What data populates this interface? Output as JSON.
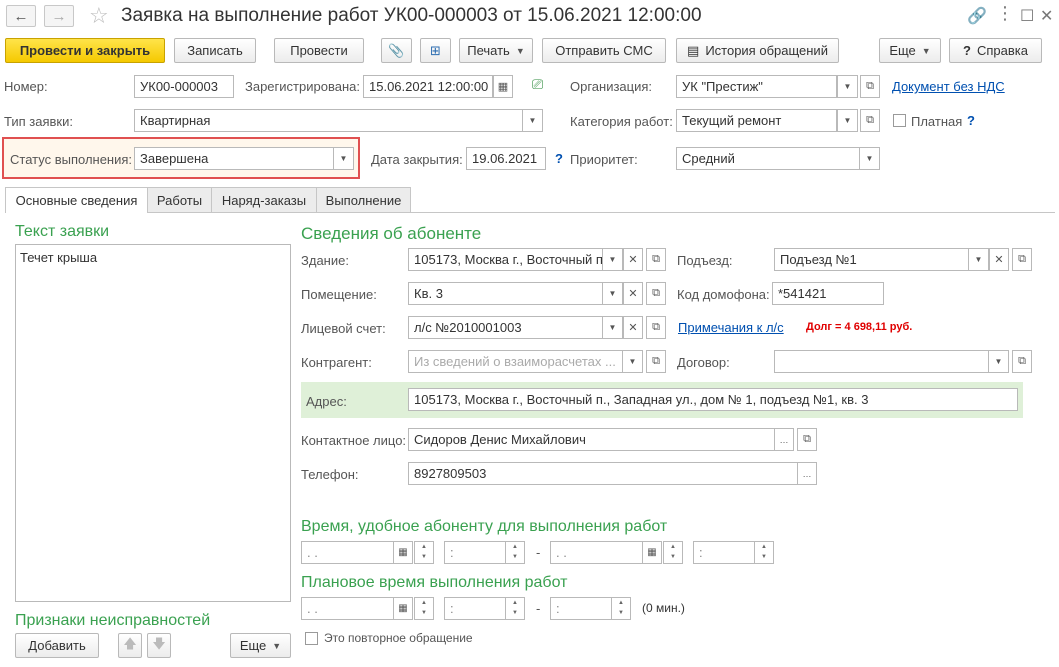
{
  "window": {
    "title": "Заявка на выполнение работ УК00-000003 от 15.06.2021 12:00:00"
  },
  "toolbar": {
    "post_close": "Провести и закрыть",
    "save": "Записать",
    "post": "Провести",
    "print": "Печать",
    "send_sms": "Отправить СМС",
    "history": "История обращений",
    "more": "Еще",
    "help": "Справка"
  },
  "header": {
    "number_label": "Номер:",
    "number_value": "УК00-000003",
    "registered_label": "Зарегистрирована:",
    "registered_value": "15.06.2021 12:00:00",
    "org_label": "Организация:",
    "org_value": "УК \"Престиж\"",
    "no_vat_link": "Документ без НДС",
    "type_label": "Тип заявки:",
    "type_value": "Квартирная",
    "category_label": "Категория работ:",
    "category_value": "Текущий ремонт",
    "paid_label": "Платная",
    "paid_help": "?",
    "status_label": "Статус выполнения:",
    "status_value": "Завершена",
    "close_date_label": "Дата закрытия:",
    "close_date_value": "19.06.2021",
    "close_date_help": "?",
    "priority_label": "Приоритет:",
    "priority_value": "Средний"
  },
  "tabs": [
    {
      "label": "Основные сведения"
    },
    {
      "label": "Работы"
    },
    {
      "label": "Наряд-заказы"
    },
    {
      "label": "Выполнение"
    }
  ],
  "left": {
    "text_header": "Текст заявки",
    "text_value": "Течет крыша",
    "defects_header": "Признаки неисправностей",
    "add_button": "Добавить",
    "more_button": "Еще"
  },
  "subscriber": {
    "header": "Сведения об абоненте",
    "building_label": "Здание:",
    "building_value": "105173, Москва г., Восточный п",
    "entrance_label": "Подъезд:",
    "entrance_value": "Подъезд №1",
    "room_label": "Помещение:",
    "room_value": "Кв. 3",
    "intercom_label": "Код домофона:",
    "intercom_value": "*541421",
    "account_label": "Лицевой счет:",
    "account_value": "л/с №2010001003",
    "account_notes_link": "Примечания к л/с",
    "debt_text": "Долг = 4 698,11 руб.",
    "counterparty_label": "Контрагент:",
    "counterparty_placeholder": "Из сведений о взаиморасчетах ...",
    "contract_label": "Договор:",
    "contract_value": "",
    "address_label": "Адрес:",
    "address_value": "105173, Москва г., Восточный п., Западная ул., дом № 1, подъезд №1, кв. 3",
    "contact_label": "Контактное лицо:",
    "contact_value": "Сидоров Денис Михайлович",
    "phone_label": "Телефон:",
    "phone_value": "8927809503"
  },
  "schedule": {
    "convenient_header": "Время, удобное абоненту для выполнения работ",
    "planned_header": "Плановое время выполнения работ",
    "date_placeholder": " .  .",
    "time_placeholder": ":",
    "dash": "-",
    "duration": "(0 мин.)",
    "repeat_label": "Это повторное обращение"
  },
  "colors": {
    "primary_button": "#f5c900",
    "highlight_border": "#e05050",
    "address_bg": "#dff0d8",
    "header_green": "#3aa150",
    "link": "#0050b0",
    "debt_red": "#e00000"
  }
}
